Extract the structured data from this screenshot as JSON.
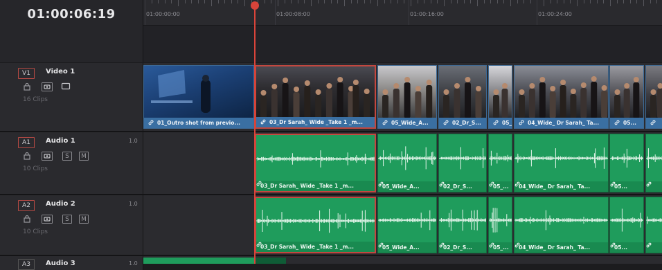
{
  "timecode": "01:00:06:19",
  "ruler": {
    "labels": [
      "01:00:00:00",
      "01:00:08:00",
      "01:00:16:00",
      "01:00:24:00"
    ]
  },
  "tracks": [
    {
      "badge": "V1",
      "name": "Video 1",
      "level": "",
      "clips": "16 Clips",
      "controls": [
        "lock",
        "eye",
        "monitor"
      ]
    },
    {
      "badge": "A1",
      "name": "Audio 1",
      "level": "1.0",
      "clips": "10 Clips",
      "controls": [
        "lock",
        "eye",
        "S",
        "M"
      ]
    },
    {
      "badge": "A2",
      "name": "Audio 2",
      "level": "1.0",
      "clips": "10 Clips",
      "controls": [
        "lock",
        "eye",
        "S",
        "M"
      ]
    },
    {
      "badge": "A3",
      "name": "Audio 3",
      "level": "1.0",
      "clips": "",
      "controls": []
    }
  ],
  "video_clips": [
    {
      "label": "01_Outro shot from previo...",
      "selected": false
    },
    {
      "label": "03_Dr Sarah_ Wide _Take 1 _m...",
      "selected": true
    },
    {
      "label": "05_Wide_A...",
      "selected": false
    },
    {
      "label": "02_Dr_S...",
      "selected": false
    },
    {
      "label": "05_...",
      "selected": false
    },
    {
      "label": "04_Wide_ Dr Sarah_ Ta...",
      "selected": false
    },
    {
      "label": "05...",
      "selected": false
    },
    {
      "label": "",
      "selected": false
    }
  ],
  "audio1_clips": [
    {
      "label": "03_Dr Sarah_ Wide _Take 1 _m...",
      "selected": true
    },
    {
      "label": "05_Wide_A...",
      "selected": false
    },
    {
      "label": "02_Dr_S...",
      "selected": false
    },
    {
      "label": "05_...",
      "selected": false
    },
    {
      "label": "04_Wide_ Dr Sarah_ Ta...",
      "selected": false
    },
    {
      "label": "05...",
      "selected": false
    },
    {
      "label": "",
      "selected": false
    }
  ],
  "audio2_clips": [
    {
      "label": "03_Dr Sarah_ Wide _Take 1 _m...",
      "selected": true
    },
    {
      "label": "05_Wide_A...",
      "selected": false
    },
    {
      "label": "02_Dr_S...",
      "selected": false
    },
    {
      "label": "05_...",
      "selected": false
    },
    {
      "label": "04_Wide_ Dr Sarah_ Ta...",
      "selected": false
    },
    {
      "label": "05...",
      "selected": false
    },
    {
      "label": "",
      "selected": false
    }
  ],
  "colors": {
    "video_clip": "#3a6fa2",
    "audio_clip": "#1f9c5c",
    "selection": "#c3473f",
    "playhead": "#d9443a"
  }
}
